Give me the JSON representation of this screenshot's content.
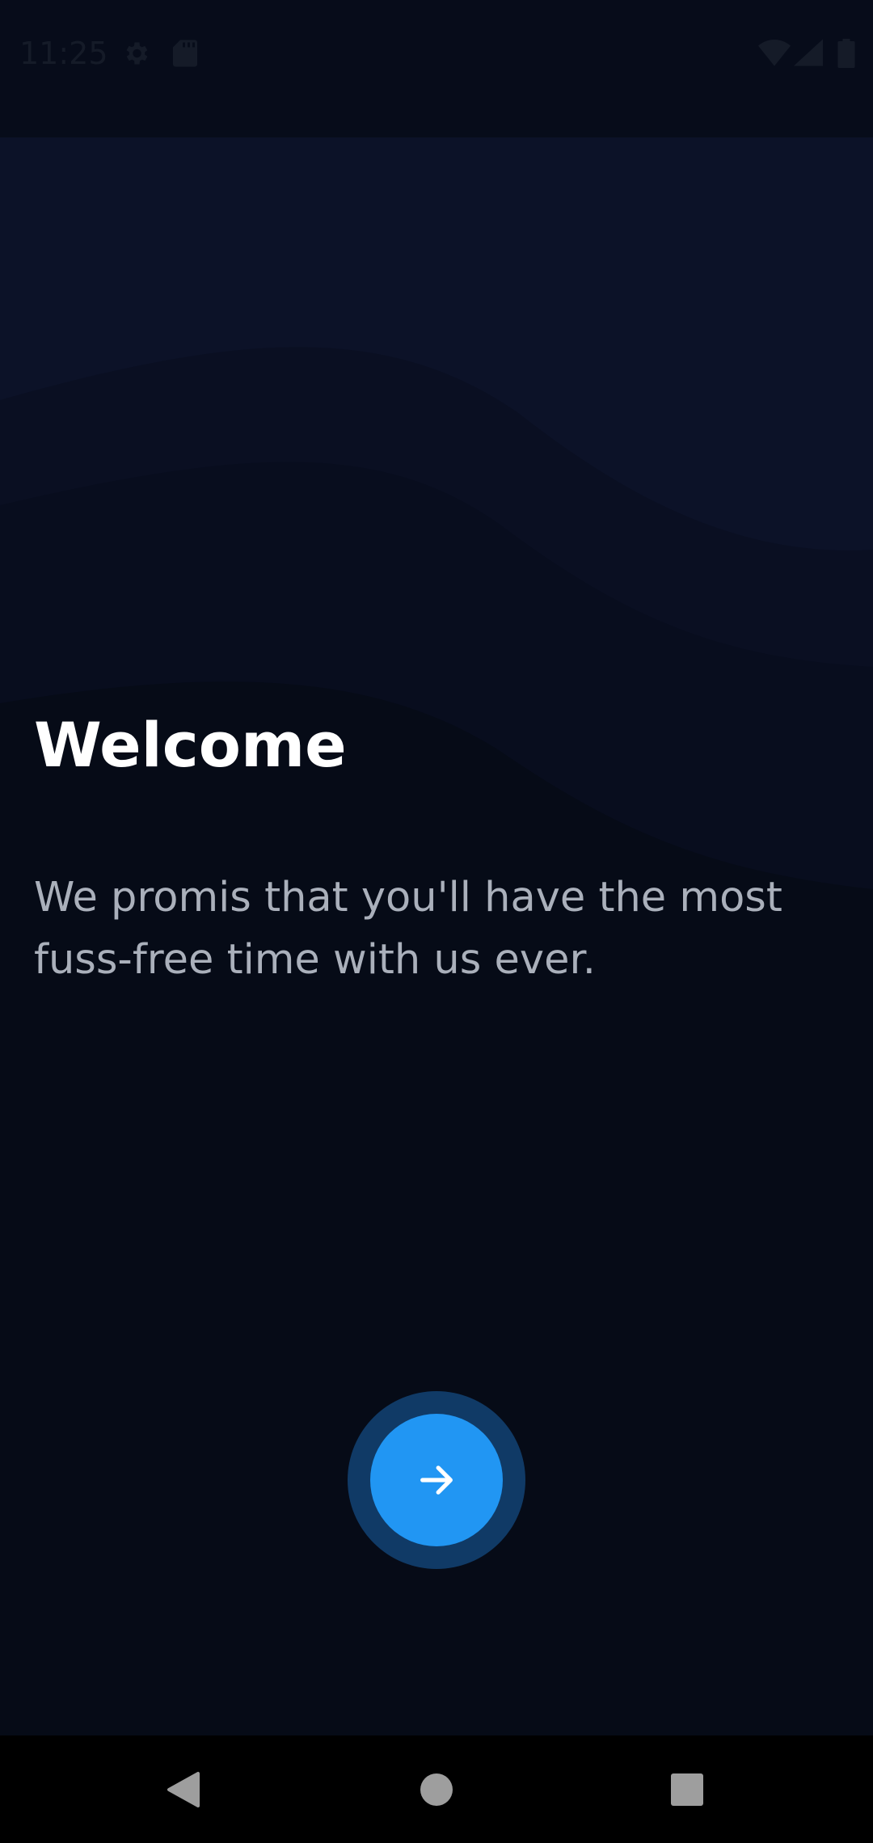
{
  "status_bar": {
    "time": "11:25",
    "icons": [
      "gear-icon",
      "sdcard-icon",
      "wifi-icon",
      "signal-icon",
      "battery-icon"
    ]
  },
  "onboarding": {
    "title": "Welcome",
    "subtitle": "We promis that you'll have the most fuss-free time with us ever.",
    "next_button_icon": "arrow-right-icon"
  },
  "nav_bar": {
    "buttons": [
      "back-icon",
      "home-icon",
      "recents-icon"
    ]
  },
  "colors": {
    "background": "#060b17",
    "wave_light": "#0c1228",
    "wave_mid": "#0a0f22",
    "accent": "#2196f3",
    "accent_ring": "#103a66",
    "title": "#ffffff",
    "subtitle": "#aab0bb"
  }
}
